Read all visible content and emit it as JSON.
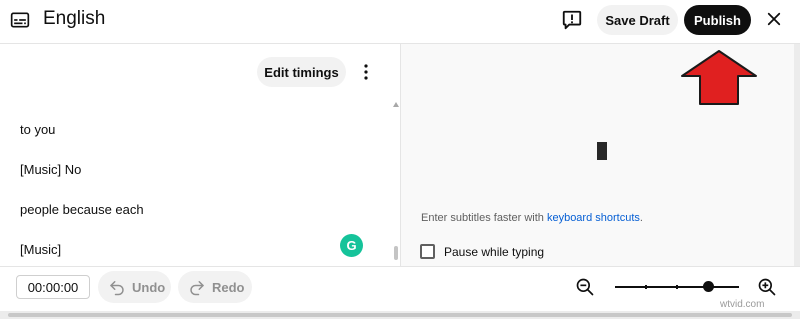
{
  "header": {
    "title": "English",
    "save_draft_label": "Save Draft",
    "publish_label": "Publish"
  },
  "editor": {
    "edit_timings_label": "Edit timings",
    "captions": [
      {
        "text": "to you"
      },
      {
        "text": "[Music] No"
      },
      {
        "text": "people because each"
      },
      {
        "text": "[Music]"
      }
    ],
    "grammarly_letter": "G"
  },
  "preview": {
    "hint_prefix": "Enter subtitles faster with ",
    "hint_link": "keyboard shortcuts",
    "hint_suffix": ".",
    "pause_label": "Pause while typing",
    "pause_checked": false
  },
  "bottom": {
    "timecode": "00:00:00",
    "undo_label": "Undo",
    "redo_label": "Redo",
    "zoom_level_fraction": 0.75
  },
  "watermark": "wtvid.com",
  "colors": {
    "publish_bg": "#0f0f0f",
    "annotation_arrow": "#e02020",
    "link": "#065fd4",
    "grammarly": "#15c39a"
  }
}
